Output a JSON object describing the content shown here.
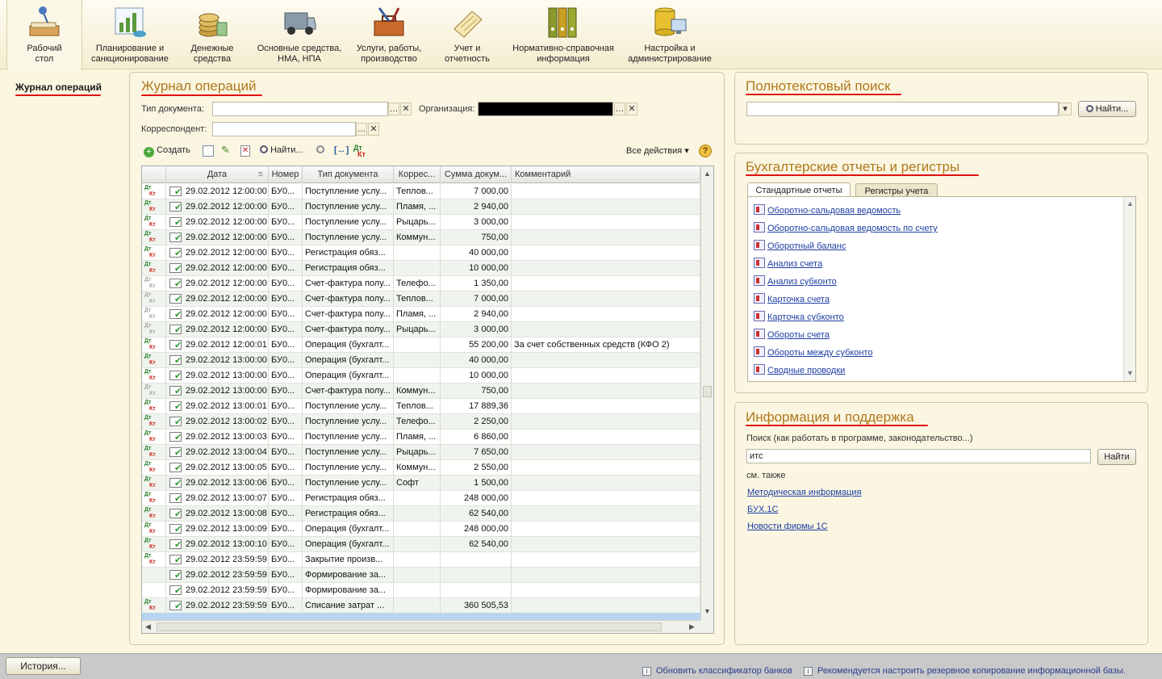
{
  "sections": [
    {
      "label": "Рабочий\nстол",
      "icon": "desk-lamp-icon"
    },
    {
      "label": "Планирование и\nсанкционирование",
      "icon": "chart-planning-icon"
    },
    {
      "label": "Денежные\nсредства",
      "icon": "coins-icon"
    },
    {
      "label": "Основные средства,\nНМА, НПА",
      "icon": "truck-icon"
    },
    {
      "label": "Услуги, работы,\nпроизводство",
      "icon": "toolbox-icon"
    },
    {
      "label": "Учет и\nотчетность",
      "icon": "notebook-icon"
    },
    {
      "label": "Нормативно-справочная\nинформация",
      "icon": "binders-icon"
    },
    {
      "label": "Настройка и\nадминистрирование",
      "icon": "database-computer-icon"
    }
  ],
  "leftnav": {
    "item": "Журнал операций"
  },
  "journal": {
    "title": "Журнал операций",
    "doc_type_label": "Тип документа:",
    "org_label": "Организация:",
    "corr_label": "Корреспондент:",
    "create_label": "Создать",
    "find_label": "Найти...",
    "all_actions_label": "Все действия ▾",
    "columns": [
      "Дата",
      "Номер",
      "Тип документа",
      "Коррес...",
      "Сумма докум...",
      "Комментарий"
    ],
    "rows": [
      {
        "date": "29.02.2012 12:00:00",
        "num": "БУ0...",
        "type": "Поступление услу...",
        "corr": "Теплов...",
        "sum": "7 000,00",
        "comment": "",
        "mark": "color"
      },
      {
        "date": "29.02.2012 12:00:00",
        "num": "БУ0...",
        "type": "Поступление услу...",
        "corr": "Пламя, ...",
        "sum": "2 940,00",
        "comment": "",
        "mark": "color"
      },
      {
        "date": "29.02.2012 12:00:00",
        "num": "БУ0...",
        "type": "Поступление услу...",
        "corr": "Рыцарь...",
        "sum": "3 000,00",
        "comment": "",
        "mark": "color"
      },
      {
        "date": "29.02.2012 12:00:00",
        "num": "БУ0...",
        "type": "Поступление услу...",
        "corr": "Коммун...",
        "sum": "750,00",
        "comment": "",
        "mark": "color"
      },
      {
        "date": "29.02.2012 12:00:00",
        "num": "БУ0...",
        "type": "Регистрация обяз...",
        "corr": "",
        "sum": "40 000,00",
        "comment": "",
        "mark": "color"
      },
      {
        "date": "29.02.2012 12:00:00",
        "num": "БУ0...",
        "type": "Регистрация обяз...",
        "corr": "",
        "sum": "10 000,00",
        "comment": "",
        "mark": "color"
      },
      {
        "date": "29.02.2012 12:00:00",
        "num": "БУ0...",
        "type": "Счет-фактура полу...",
        "corr": "Телефо...",
        "sum": "1 350,00",
        "comment": "",
        "mark": "grey"
      },
      {
        "date": "29.02.2012 12:00:00",
        "num": "БУ0...",
        "type": "Счет-фактура полу...",
        "corr": "Теплов...",
        "sum": "7 000,00",
        "comment": "",
        "mark": "grey"
      },
      {
        "date": "29.02.2012 12:00:00",
        "num": "БУ0...",
        "type": "Счет-фактура полу...",
        "corr": "Пламя, ...",
        "sum": "2 940,00",
        "comment": "",
        "mark": "grey"
      },
      {
        "date": "29.02.2012 12:00:00",
        "num": "БУ0...",
        "type": "Счет-фактура полу...",
        "corr": "Рыцарь...",
        "sum": "3 000,00",
        "comment": "",
        "mark": "grey"
      },
      {
        "date": "29.02.2012 12:00:01",
        "num": "БУ0...",
        "type": "Операция (бухгалт...",
        "corr": "",
        "sum": "55 200,00",
        "comment": "За счет собственных средств (КФО 2)",
        "mark": "color"
      },
      {
        "date": "29.02.2012 13:00:00",
        "num": "БУ0...",
        "type": "Операция (бухгалт...",
        "corr": "",
        "sum": "40 000,00",
        "comment": "",
        "mark": "color"
      },
      {
        "date": "29.02.2012 13:00:00",
        "num": "БУ0...",
        "type": "Операция (бухгалт...",
        "corr": "",
        "sum": "10 000,00",
        "comment": "",
        "mark": "color"
      },
      {
        "date": "29.02.2012 13:00:00",
        "num": "БУ0...",
        "type": "Счет-фактура полу...",
        "corr": "Коммун...",
        "sum": "750,00",
        "comment": "",
        "mark": "grey"
      },
      {
        "date": "29.02.2012 13:00:01",
        "num": "БУ0...",
        "type": "Поступление услу...",
        "corr": "Теплов...",
        "sum": "17 889,36",
        "comment": "",
        "mark": "color"
      },
      {
        "date": "29.02.2012 13:00:02",
        "num": "БУ0...",
        "type": "Поступление услу...",
        "corr": "Телефо...",
        "sum": "2 250,00",
        "comment": "",
        "mark": "color"
      },
      {
        "date": "29.02.2012 13:00:03",
        "num": "БУ0...",
        "type": "Поступление услу...",
        "corr": "Пламя, ...",
        "sum": "6 860,00",
        "comment": "",
        "mark": "color"
      },
      {
        "date": "29.02.2012 13:00:04",
        "num": "БУ0...",
        "type": "Поступление услу...",
        "corr": "Рыцарь...",
        "sum": "7 650,00",
        "comment": "",
        "mark": "color"
      },
      {
        "date": "29.02.2012 13:00:05",
        "num": "БУ0...",
        "type": "Поступление услу...",
        "corr": "Коммун...",
        "sum": "2 550,00",
        "comment": "",
        "mark": "color"
      },
      {
        "date": "29.02.2012 13:00:06",
        "num": "БУ0...",
        "type": "Поступление услу...",
        "corr": "Софт",
        "sum": "1 500,00",
        "comment": "",
        "mark": "color"
      },
      {
        "date": "29.02.2012 13:00:07",
        "num": "БУ0...",
        "type": "Регистрация обяз...",
        "corr": "",
        "sum": "248 000,00",
        "comment": "",
        "mark": "color"
      },
      {
        "date": "29.02.2012 13:00:08",
        "num": "БУ0...",
        "type": "Регистрация обяз...",
        "corr": "",
        "sum": "62 540,00",
        "comment": "",
        "mark": "color"
      },
      {
        "date": "29.02.2012 13:00:09",
        "num": "БУ0...",
        "type": "Операция (бухгалт...",
        "corr": "",
        "sum": "248 000,00",
        "comment": "",
        "mark": "color"
      },
      {
        "date": "29.02.2012 13:00:10",
        "num": "БУ0...",
        "type": "Операция (бухгалт...",
        "corr": "",
        "sum": "62 540,00",
        "comment": "",
        "mark": "color"
      },
      {
        "date": "29.02.2012 23:59:59",
        "num": "БУ0...",
        "type": "Закрытие произв...",
        "corr": "",
        "sum": "",
        "comment": "",
        "mark": "color"
      },
      {
        "date": "29.02.2012 23:59:59",
        "num": "БУ0...",
        "type": "Формирование за...",
        "corr": "",
        "sum": "",
        "comment": "",
        "mark": "none"
      },
      {
        "date": "29.02.2012 23:59:59",
        "num": "БУ0...",
        "type": "Формирование за...",
        "corr": "",
        "sum": "",
        "comment": "",
        "mark": "none"
      },
      {
        "date": "29.02.2012 23:59:59",
        "num": "БУ0...",
        "type": "Списание затрат ...",
        "corr": "",
        "sum": "360 505,53",
        "comment": "",
        "mark": "color"
      }
    ]
  },
  "search": {
    "title": "Полнотекстовый поиск",
    "find_label": "Найти..."
  },
  "reports": {
    "title": "Бухгалтерские отчеты и регистры",
    "tab_standard": "Стандартные отчеты",
    "tab_registers": "Регистры учета",
    "items": [
      "Оборотно-сальдовая ведомость",
      "Оборотно-сальдовая ведомость по счету",
      "Оборотный баланс",
      "Анализ счета",
      "Анализ субконто",
      "Карточка счета",
      "Карточка субконто",
      "Обороты счета",
      "Обороты между субконто",
      "Сводные проводки"
    ]
  },
  "info": {
    "title": "Информация и поддержка",
    "search_label": "Поиск (как работать в программе, законодательство...)",
    "search_value": "итс",
    "find_button": "Найти",
    "see_also": "см. также",
    "links": [
      "Методическая информация",
      "БУХ.1С",
      "Новости фирмы 1С"
    ]
  },
  "statusbar": {
    "history_button": "История...",
    "msg1": "Обновить классификатор банков",
    "msg2": "Рекомендуется настроить резервное копирование информационной базы."
  },
  "colors": {
    "accent_title": "#b0781a",
    "underline": "#e01010",
    "link": "#1d3ea3",
    "selected_row": "#b8d4f0"
  }
}
